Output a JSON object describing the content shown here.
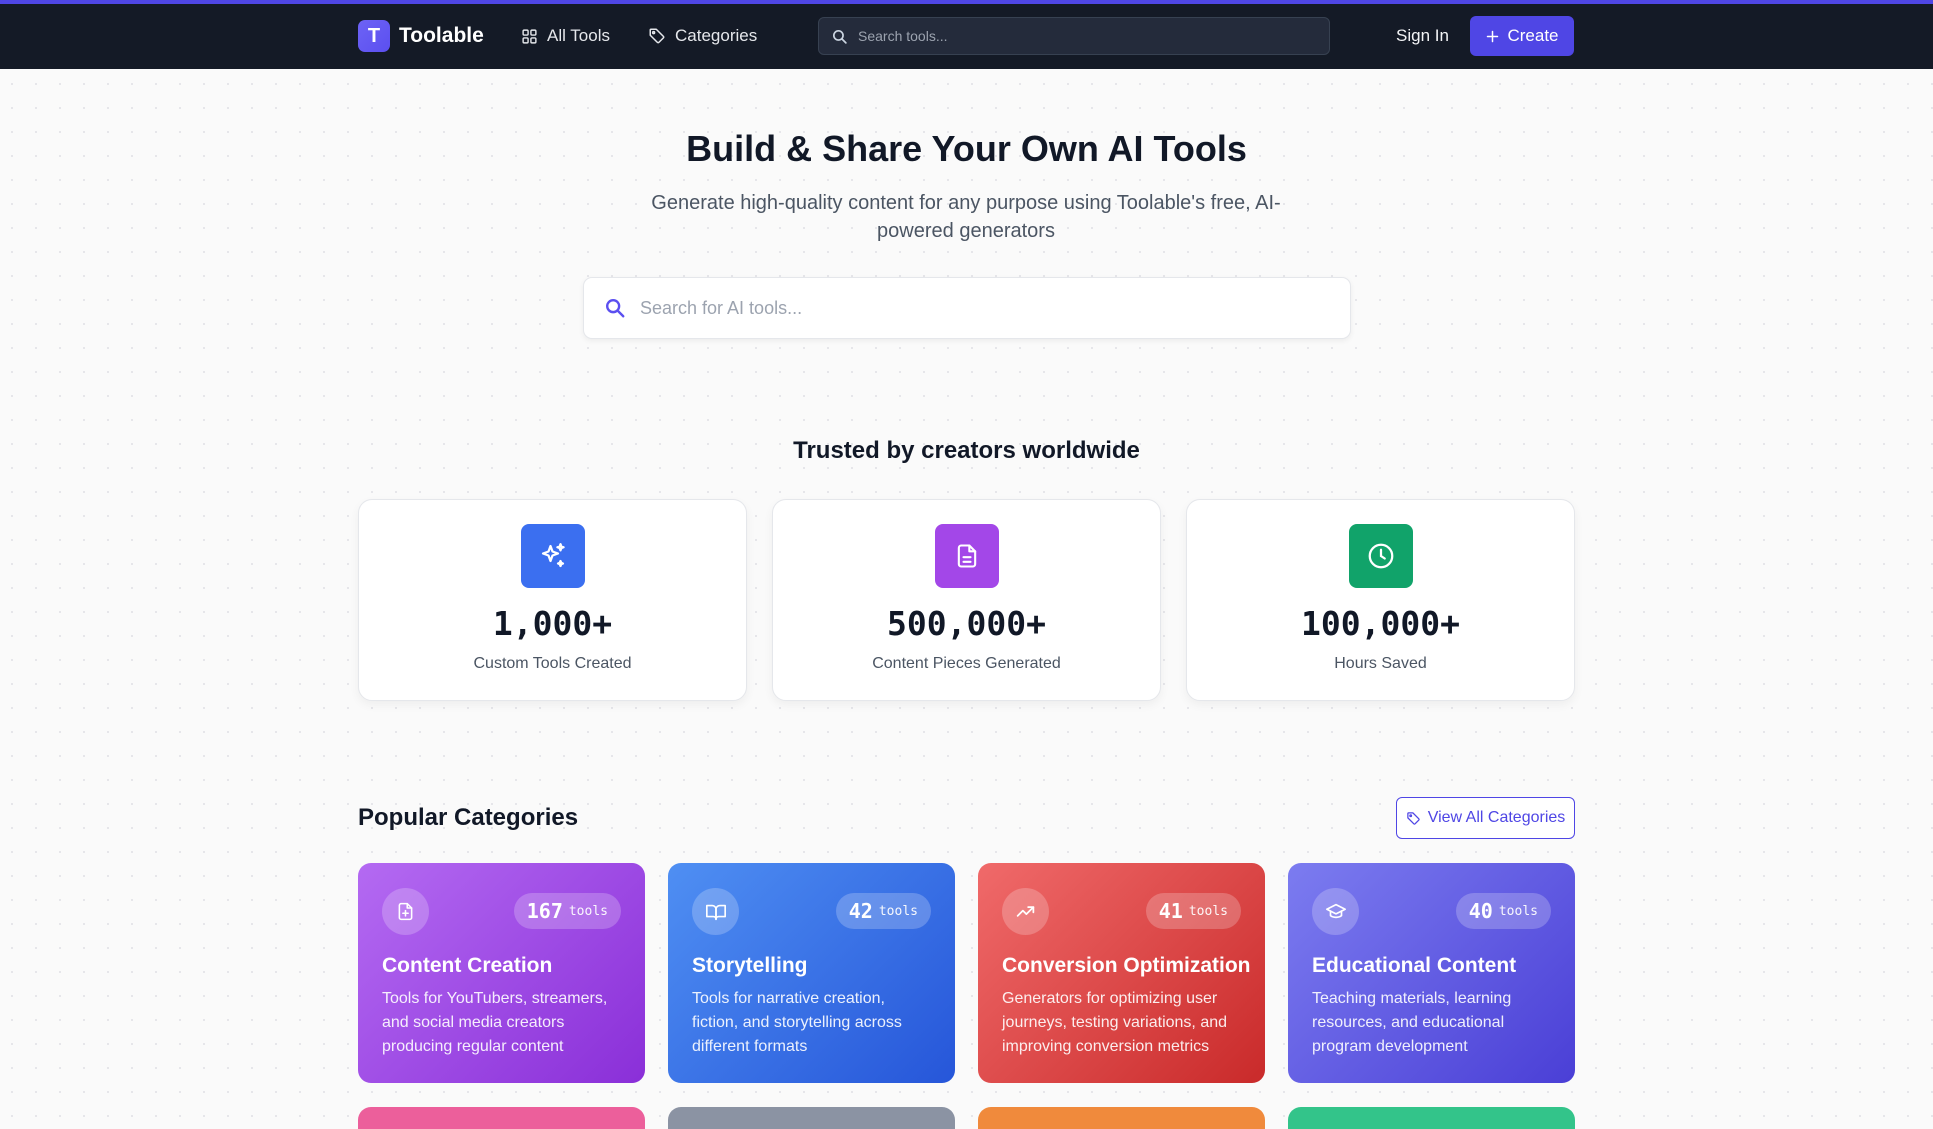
{
  "header": {
    "logo_letter": "T",
    "brand": "Toolable",
    "nav": [
      {
        "label": "All Tools",
        "icon": "grid-icon"
      },
      {
        "label": "Categories",
        "icon": "tag-icon"
      }
    ],
    "search_placeholder": "Search tools...",
    "sign_in": "Sign In",
    "create": "Create"
  },
  "hero": {
    "title": "Build & Share Your Own AI Tools",
    "subtitle": "Generate high-quality content for any purpose using Toolable's free, AI-powered generators",
    "search_placeholder": "Search for AI tools..."
  },
  "stats": {
    "title": "Trusted by creators worldwide",
    "items": [
      {
        "value": "1,000+",
        "label": "Custom Tools Created",
        "icon": "sparkles-icon",
        "color": "#3b6ff0"
      },
      {
        "value": "500,000+",
        "label": "Content Pieces Generated",
        "icon": "document-icon",
        "color": "#a347e8"
      },
      {
        "value": "100,000+",
        "label": "Hours Saved",
        "icon": "clock-icon",
        "color": "#11a36a"
      }
    ]
  },
  "categories": {
    "title": "Popular Categories",
    "view_all": "View All Categories",
    "unit": "tools",
    "items": [
      {
        "count": "167",
        "name": "Content Creation",
        "desc": "Tools for YouTubers, streamers, and social media creators producing regular content",
        "icon": "file-plus-icon",
        "gradient": [
          "#b46af2",
          "#8a2fd8"
        ]
      },
      {
        "count": "42",
        "name": "Storytelling",
        "desc": "Tools for narrative creation, fiction, and storytelling across different formats",
        "icon": "book-icon",
        "gradient": [
          "#4f8ff3",
          "#2656d9"
        ]
      },
      {
        "count": "41",
        "name": "Conversion Optimization",
        "desc": "Generators for optimizing user journeys, testing variations, and improving conversion metrics",
        "icon": "trending-up-icon",
        "gradient": [
          "#f06a6a",
          "#c92a2a"
        ]
      },
      {
        "count": "40",
        "name": "Educational Content",
        "desc": "Teaching materials, learning resources, and educational program development",
        "icon": "graduation-cap-icon",
        "gradient": [
          "#7c7cf0",
          "#4a3fd6"
        ]
      }
    ],
    "peek_colors": [
      "#ec5f9b",
      "#8b93a3",
      "#f08a3c",
      "#33c48a"
    ]
  }
}
